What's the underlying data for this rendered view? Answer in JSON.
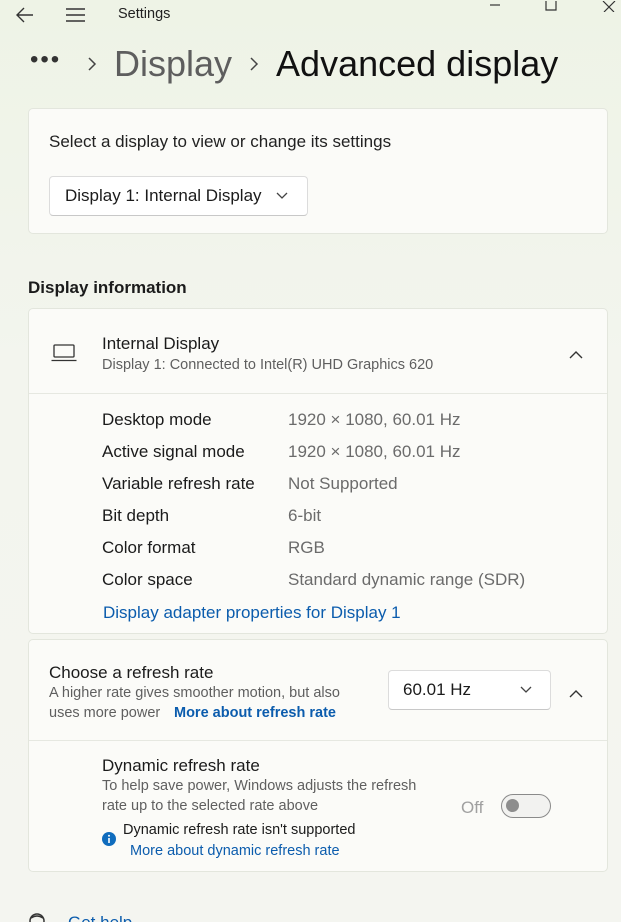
{
  "window": {
    "title": "Settings"
  },
  "breadcrumb": {
    "dots": "•••",
    "parent": "Display",
    "current": "Advanced display"
  },
  "select_display": {
    "label": "Select a display to view or change its settings",
    "selected": "Display 1: Internal Display"
  },
  "display_info": {
    "section_title": "Display information",
    "name": "Internal Display",
    "subtitle": "Display 1: Connected to Intel(R) UHD Graphics 620",
    "rows": [
      {
        "label": "Desktop mode",
        "value": "1920 × 1080, 60.01 Hz"
      },
      {
        "label": "Active signal mode",
        "value": "1920 × 1080, 60.01 Hz"
      },
      {
        "label": "Variable refresh rate",
        "value": "Not Supported"
      },
      {
        "label": "Bit depth",
        "value": "6-bit"
      },
      {
        "label": "Color format",
        "value": "RGB"
      },
      {
        "label": "Color space",
        "value": "Standard dynamic range (SDR)"
      }
    ],
    "adapter_link": "Display adapter properties for Display 1"
  },
  "refresh_rate": {
    "title": "Choose a refresh rate",
    "desc_line1": "A higher rate gives smoother motion, but also",
    "desc_line2": "uses more power",
    "more_link": "More about refresh rate",
    "selected": "60.01 Hz"
  },
  "dynamic_refresh": {
    "title": "Dynamic refresh rate",
    "desc_line1": "To help save power, Windows adjusts the refresh",
    "desc_line2": "rate up to the selected rate above",
    "toggle_state": "Off",
    "notice": "Dynamic refresh rate isn't supported",
    "notice_link": "More about dynamic refresh rate"
  },
  "footer": {
    "get_help": "Get help"
  },
  "colors": {
    "accent_link": "#0b5cad",
    "info_icon": "#0f6cbd"
  }
}
